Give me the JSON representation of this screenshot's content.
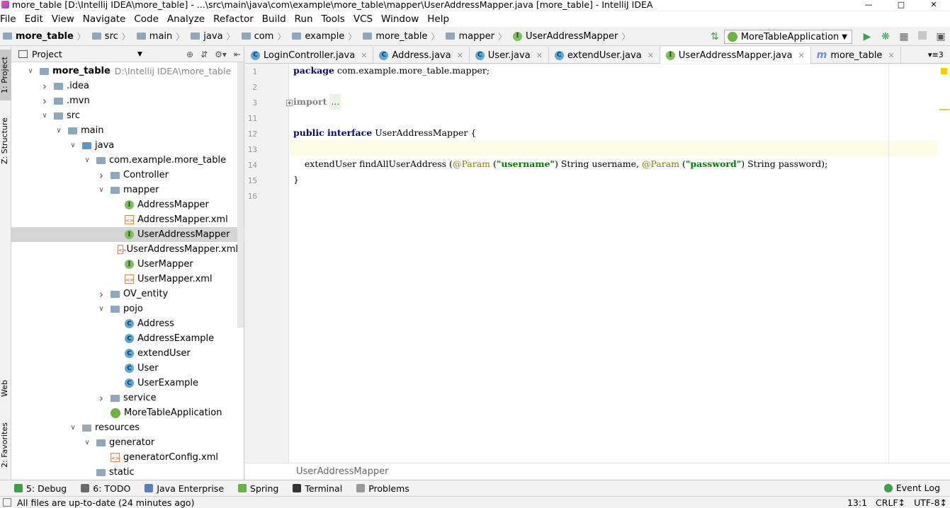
{
  "window": {
    "title": "more_table [D:\\Intellij IDEA\\more_table] - ...\\src\\main\\java\\com\\example\\more_table\\mapper\\UserAddressMapper.java [more_table] - IntelliJ IDEA"
  },
  "menu": [
    "File",
    "Edit",
    "View",
    "Navigate",
    "Code",
    "Analyze",
    "Refactor",
    "Build",
    "Run",
    "Tools",
    "VCS",
    "Window",
    "Help"
  ],
  "breadcrumbs": [
    "more_table",
    "src",
    "main",
    "java",
    "com",
    "example",
    "more_table",
    "mapper",
    "UserAddressMapper"
  ],
  "run_config": "MoreTableApplication",
  "left_strip": [
    "1: Project",
    "Z: Structure",
    "Web",
    "2: Favorites"
  ],
  "project_panel": {
    "title": "Project",
    "tree": [
      {
        "label": "more_table",
        "path": "D:\\Intellij IDEA\\more_table",
        "depth": 0,
        "arrow": "down",
        "icon": "folder-icon",
        "bold": true
      },
      {
        "label": ".idea",
        "depth": 1,
        "arrow": "right",
        "icon": "folder-icon"
      },
      {
        "label": ".mvn",
        "depth": 1,
        "arrow": "right",
        "icon": "folder-icon"
      },
      {
        "label": "src",
        "depth": 1,
        "arrow": "down",
        "icon": "folder-icon"
      },
      {
        "label": "main",
        "depth": 2,
        "arrow": "down",
        "icon": "folder-icon"
      },
      {
        "label": "java",
        "depth": 3,
        "arrow": "down",
        "icon": "source-folder-icon"
      },
      {
        "label": "com.example.more_table",
        "depth": 4,
        "arrow": "down",
        "icon": "package-icon"
      },
      {
        "label": "Controller",
        "depth": 5,
        "arrow": "right",
        "icon": "package-icon"
      },
      {
        "label": "mapper",
        "depth": 5,
        "arrow": "down",
        "icon": "package-icon"
      },
      {
        "label": "AddressMapper",
        "depth": 6,
        "arrow": "",
        "icon": "interface-icon"
      },
      {
        "label": "AddressMapper.xml",
        "depth": 6,
        "arrow": "",
        "icon": "xml-file-icon"
      },
      {
        "label": "UserAddressMapper",
        "depth": 6,
        "arrow": "",
        "icon": "interface-icon",
        "selected": true
      },
      {
        "label": "UserAddressMapper.xml",
        "depth": 6,
        "arrow": "",
        "icon": "xml-file-icon"
      },
      {
        "label": "UserMapper",
        "depth": 6,
        "arrow": "",
        "icon": "interface-icon"
      },
      {
        "label": "UserMapper.xml",
        "depth": 6,
        "arrow": "",
        "icon": "xml-file-icon"
      },
      {
        "label": "OV_entity",
        "depth": 5,
        "arrow": "right",
        "icon": "package-icon"
      },
      {
        "label": "pojo",
        "depth": 5,
        "arrow": "down",
        "icon": "package-icon"
      },
      {
        "label": "Address",
        "depth": 6,
        "arrow": "",
        "icon": "class-icon"
      },
      {
        "label": "AddressExample",
        "depth": 6,
        "arrow": "",
        "icon": "class-icon"
      },
      {
        "label": "extendUser",
        "depth": 6,
        "arrow": "",
        "icon": "class-icon"
      },
      {
        "label": "User",
        "depth": 6,
        "arrow": "",
        "icon": "class-icon"
      },
      {
        "label": "UserExample",
        "depth": 6,
        "arrow": "",
        "icon": "class-icon"
      },
      {
        "label": "service",
        "depth": 5,
        "arrow": "right",
        "icon": "package-icon"
      },
      {
        "label": "MoreTableApplication",
        "depth": 5,
        "arrow": "",
        "icon": "spring-app-icon"
      },
      {
        "label": "resources",
        "depth": 3,
        "arrow": "down",
        "icon": "resources-folder-icon"
      },
      {
        "label": "generator",
        "depth": 4,
        "arrow": "down",
        "icon": "folder-icon"
      },
      {
        "label": "generatorConfig.xml",
        "depth": 5,
        "arrow": "",
        "icon": "xml-file-icon"
      },
      {
        "label": "static",
        "depth": 4,
        "arrow": "",
        "icon": "folder-icon"
      }
    ]
  },
  "tabs": [
    {
      "label": "LoginController.java",
      "icon": "class-icon",
      "active": false
    },
    {
      "label": "Address.java",
      "icon": "class-icon",
      "active": false
    },
    {
      "label": "User.java",
      "icon": "class-icon",
      "active": false
    },
    {
      "label": "extendUser.java",
      "icon": "class-icon",
      "active": false
    },
    {
      "label": "UserAddressMapper.java",
      "icon": "interface-icon",
      "active": true
    },
    {
      "label": "more_table",
      "icon": "maven-icon",
      "active": false
    }
  ],
  "tab_overflow": "3",
  "editor": {
    "line_numbers": [
      "1",
      "2",
      "3",
      "11",
      "12",
      "13",
      "14",
      "15",
      "16"
    ],
    "current_line": "13",
    "lines": [
      [
        {
          "t": "package",
          "c": "kw"
        },
        {
          "t": " com.example.more_table.mapper;",
          "c": ""
        }
      ],
      [],
      [
        {
          "t": "import",
          "c": "kw-fold"
        },
        {
          "t": " ",
          "c": ""
        },
        {
          "t": "...",
          "c": "fold"
        }
      ],
      [],
      [
        {
          "t": "public interface",
          "c": "kw"
        },
        {
          "t": " UserAddressMapper {",
          "c": ""
        }
      ],
      [],
      [
        {
          "t": "    extendUser findAllUserAddress (",
          "c": ""
        },
        {
          "t": "@Param",
          "c": "ann"
        },
        {
          "t": " (",
          "c": ""
        },
        {
          "t": "\"username\"",
          "c": "str"
        },
        {
          "t": ") String username, ",
          "c": ""
        },
        {
          "t": "@Param",
          "c": "ann"
        },
        {
          "t": " (",
          "c": ""
        },
        {
          "t": "\"password\"",
          "c": "str"
        },
        {
          "t": ") String password);",
          "c": ""
        }
      ],
      [
        {
          "t": "}",
          "c": ""
        }
      ],
      []
    ],
    "breadcrumb": "UserAddressMapper"
  },
  "tool_windows": [
    {
      "label": "5: Debug",
      "icon": "debug-icon",
      "color": "#3f9e4a"
    },
    {
      "label": "6: TODO",
      "icon": "todo-icon",
      "color": "#6a6a6a"
    },
    {
      "label": "Java Enterprise",
      "icon": "java-enterprise-icon",
      "color": "#5b7fbd"
    },
    {
      "label": "Spring",
      "icon": "spring-icon",
      "color": "#6db33f"
    },
    {
      "label": "Terminal",
      "icon": "terminal-icon",
      "color": "#333333"
    },
    {
      "label": "Problems",
      "icon": "problems-icon",
      "color": "#999999"
    }
  ],
  "event_log": "Event Log",
  "status": {
    "message": "All files are up-to-date (24 minutes ago)",
    "position": "13:1",
    "line_sep": "CRLF↕",
    "encoding": "UTF-8↕"
  }
}
